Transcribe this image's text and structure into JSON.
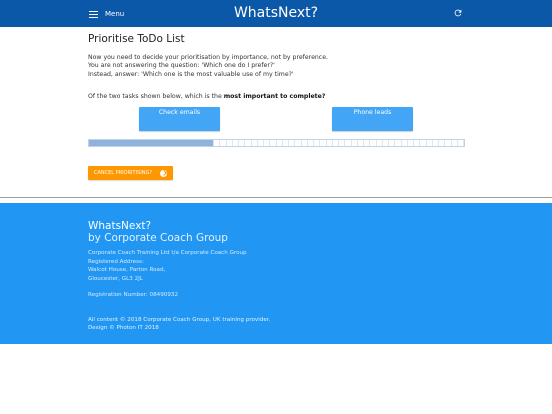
{
  "header": {
    "menu_label": "Menu",
    "brand": "WhatsNext?",
    "refresh_icon": "refresh-icon"
  },
  "main": {
    "title": "Prioritise ToDo List",
    "intro_lines": [
      "Now you need to decide your prioritisation by importance, not by preference.",
      "You are not answering the question: 'Which one do I prefer?'",
      "Instead, answer: 'Which one is the most valuable use of my time?'"
    ],
    "question_prefix": "Of the two tasks shown below, which is the ",
    "question_bold": "most important to complete?",
    "task_a": "Check emails",
    "task_b": "Phone leads",
    "progress": 0.33,
    "cancel_label": "CANCEL PRIORITISING?"
  },
  "footer": {
    "title": "WhatsNext?",
    "subtitle": "by Corporate Coach Group",
    "address_lines": [
      "Corporate Coach Training Ltd t/a Corporate Coach Group",
      "Registered Address:",
      "Walcot House, Parton Road,",
      "Gloucester, GL3 2JL"
    ],
    "registration": "Registration Number: 08490932",
    "copyright": "All content © 2018 Corporate Coach Group, UK training provider.",
    "design": "Design © Photon IT 2018"
  },
  "colors": {
    "header_bg": "#0c58a8",
    "task_button": "#42a5f5",
    "cancel_button": "#ff9800",
    "footer_bg": "#2196f3"
  }
}
